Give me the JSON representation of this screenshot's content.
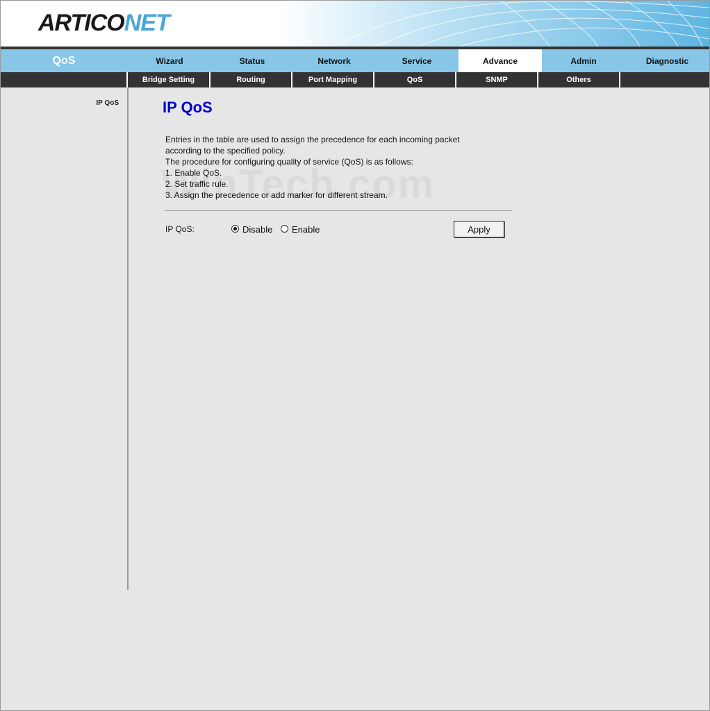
{
  "brand": {
    "part1": "ARTICO",
    "part2": "NET",
    "accent": "#4aa7d9"
  },
  "section_title": "QoS",
  "main_nav": [
    {
      "label": "Wizard"
    },
    {
      "label": "Status"
    },
    {
      "label": "Network"
    },
    {
      "label": "Service"
    },
    {
      "label": "Advance",
      "active": true
    },
    {
      "label": "Admin"
    },
    {
      "label": "Diagnostic"
    }
  ],
  "sub_nav": [
    {
      "label": "Bridge Setting"
    },
    {
      "label": "Routing"
    },
    {
      "label": "Port Mapping"
    },
    {
      "label": "QoS"
    },
    {
      "label": "SNMP"
    },
    {
      "label": "Others"
    }
  ],
  "sidebar": {
    "items": [
      {
        "label": "IP QoS"
      }
    ]
  },
  "page": {
    "title": "IP QoS",
    "description_lines": [
      "Entries in the table are used to assign the precedence for each incoming packet",
      "according to the specified policy.",
      "The procedure for configuring quality of service (QoS) is as follows:",
      "1. Enable QoS.",
      "2. Set traffic rule.",
      "3. Assign the precedence or add marker for different stream."
    ],
    "watermark": "WinTech.com",
    "ip_qos_label": "IP QoS:",
    "options": {
      "disable": "Disable",
      "enable": "Enable",
      "selected": "disable"
    },
    "apply_label": "Apply"
  }
}
